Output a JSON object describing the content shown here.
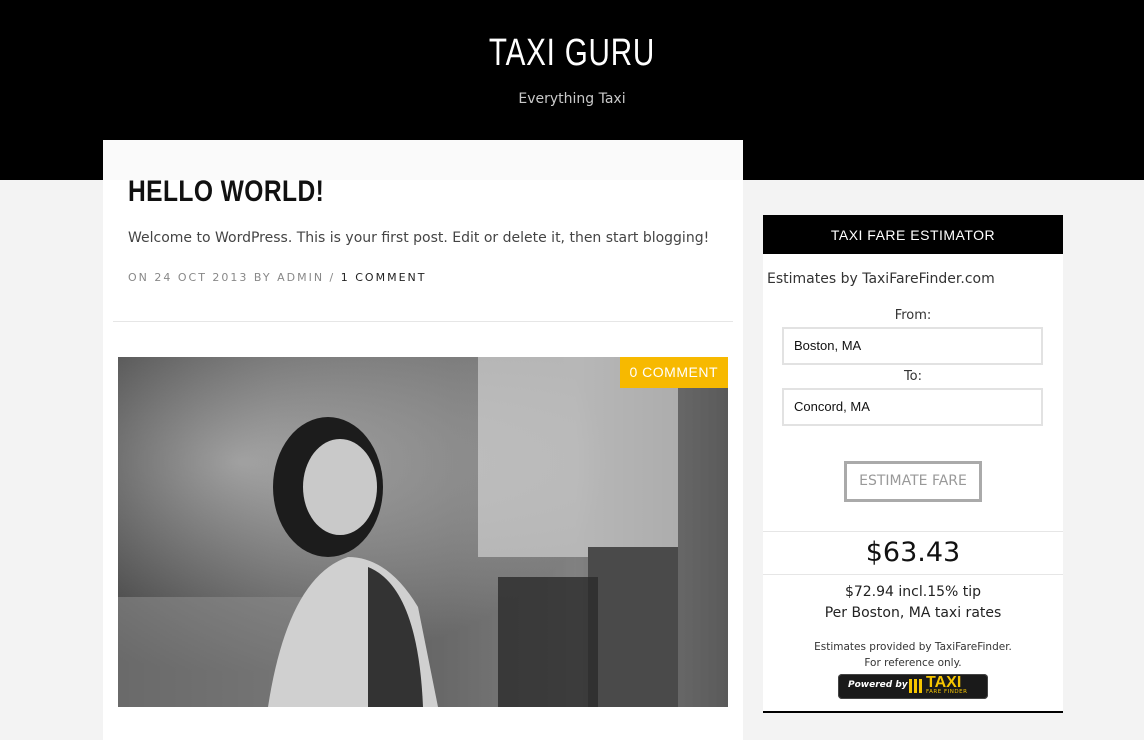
{
  "header": {
    "site_title": "TAXI GURU",
    "tagline": "Everything Taxi"
  },
  "post": {
    "title": "HELLO WORLD!",
    "excerpt": "Welcome to WordPress. This is your first post. Edit or delete it, then start blogging!",
    "meta_prefix": "ON 24 OCT 2013 BY ADMIN / ",
    "comments_link": "1 COMMENT",
    "featured_badge": "0 COMMENT"
  },
  "widget": {
    "title": "TAXI FARE ESTIMATOR",
    "estimates_by": "Estimates by TaxiFareFinder.com",
    "from_label": "From:",
    "from_value": "Boston, MA",
    "to_label": "To:",
    "to_value": "Concord, MA",
    "button_label": "ESTIMATE FARE",
    "fare": "$63.43",
    "tip_line": "$72.94 incl.15% tip",
    "rates_line": "Per Boston, MA taxi rates",
    "provided_line1": "Estimates provided by TaxiFareFinder.",
    "provided_line2": "For reference only.",
    "powered_by": "Powered by",
    "powered_brand": "TAXI",
    "powered_sub": "FARE FINDER"
  },
  "colors": {
    "header_bg": "#000000",
    "badge": "#f7b900",
    "page_bg": "#f3f3f3"
  }
}
